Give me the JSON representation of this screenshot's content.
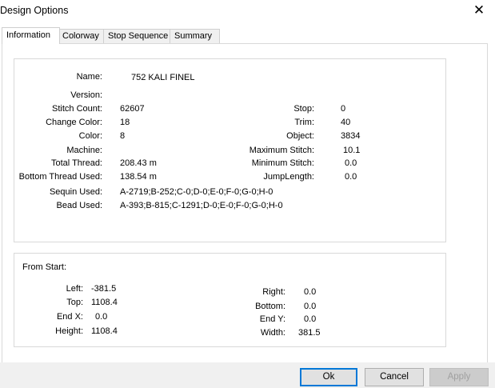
{
  "window": {
    "title": "Design Options",
    "close_glyph": "✕"
  },
  "tabs": [
    {
      "label": "Information"
    },
    {
      "label": "Colorway"
    },
    {
      "label": "Stop Sequence"
    },
    {
      "label": "Summary"
    }
  ],
  "info": {
    "name_label": "Name:",
    "name_value": "752 KALI FINEL",
    "version_label": "Version:",
    "version_value": "",
    "stitch_count_label": "Stitch Count:",
    "stitch_count_value": "62607",
    "change_color_label": "Change Color:",
    "change_color_value": "18",
    "color_label": "Color:",
    "color_value": "8",
    "machine_label": "Machine:",
    "machine_value": "",
    "total_thread_label": "Total Thread:",
    "total_thread_value": "208.43 m",
    "bottom_thread_label": "Bottom Thread Used:",
    "bottom_thread_value": "138.54 m",
    "sequin_label": "Sequin Used:",
    "sequin_value": "A-2719;B-252;C-0;D-0;E-0;F-0;G-0;H-0",
    "bead_label": "Bead Used:",
    "bead_value": "A-393;B-815;C-1291;D-0;E-0;F-0;G-0;H-0",
    "stop_label": "Stop:",
    "stop_value": "0",
    "trim_label": "Trim:",
    "trim_value": "40",
    "object_label": "Object:",
    "object_value": "3834",
    "max_stitch_label": "Maximum Stitch:",
    "max_stitch_value": "10.1",
    "min_stitch_label": "Minimum Stitch:",
    "min_stitch_value": "0.0",
    "jump_length_label": "JumpLength:",
    "jump_length_value": "0.0"
  },
  "from_start": {
    "title": "From Start:",
    "left_label": "Left:",
    "left_value": "-381.5",
    "top_label": "Top:",
    "top_value": "1108.4",
    "endx_label": "End X:",
    "endx_value": "0.0",
    "height_label": "Height:",
    "height_value": "1108.4",
    "right_label": "Right:",
    "right_value": "0.0",
    "bottom_label": "Bottom:",
    "bottom_value": "0.0",
    "endy_label": "End Y:",
    "endy_value": "0.0",
    "width_label": "Width:",
    "width_value": "381.5"
  },
  "buttons": {
    "ok": "Ok",
    "cancel": "Cancel",
    "apply": "Apply"
  },
  "colors": {
    "accent": "#0078d7",
    "panel_border": "#d9d9d9",
    "bar": "#f0f0f0"
  }
}
